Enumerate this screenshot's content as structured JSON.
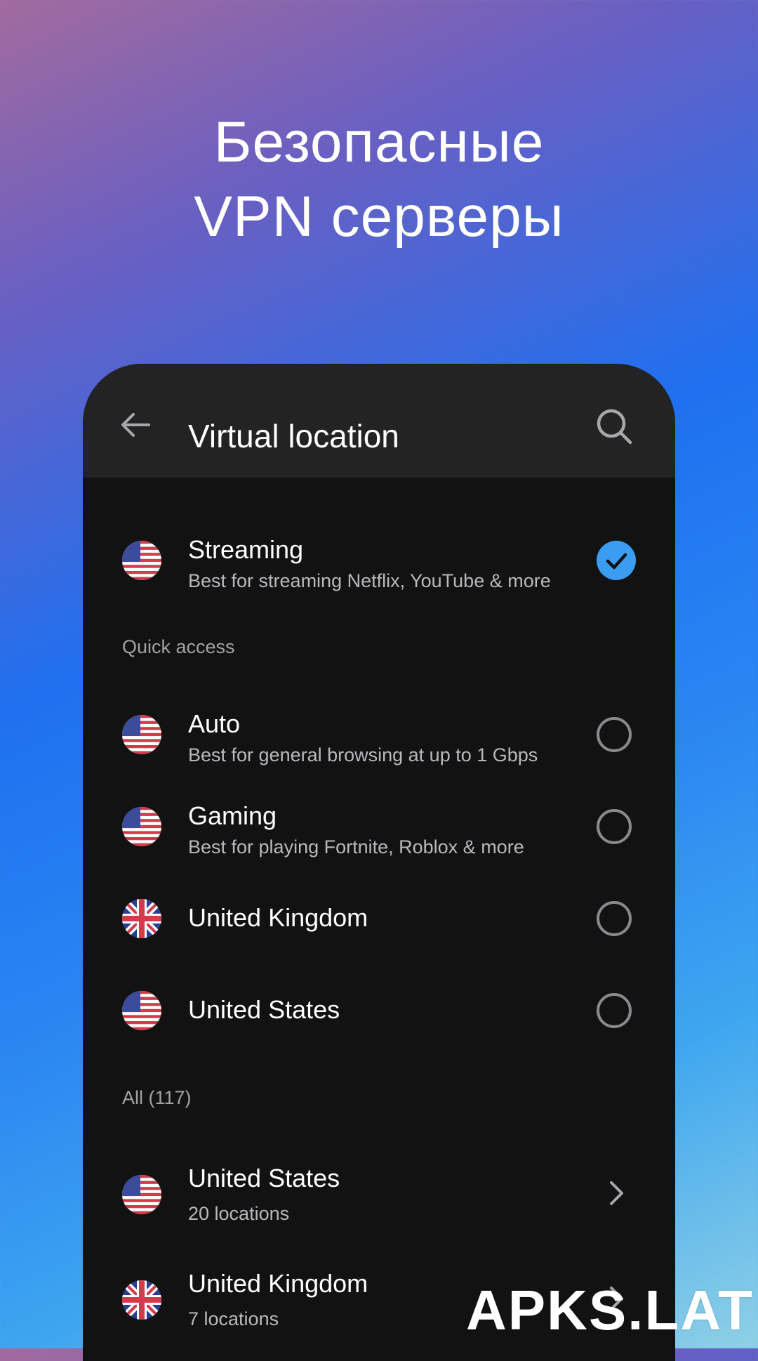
{
  "headline": {
    "line1": "Безопасные",
    "line2": "VPN серверы"
  },
  "appbar": {
    "title": "Virtual location",
    "back_icon": "arrow-left-icon",
    "search_icon": "search-icon"
  },
  "selected": {
    "title": "Streaming",
    "subtitle": "Best for streaming Netflix, YouTube & more",
    "flag": "us-flag-icon",
    "selected": true
  },
  "quick_access": {
    "label": "Quick access",
    "items": [
      {
        "title": "Auto",
        "subtitle": "Best for general browsing at up to 1 Gbps",
        "flag": "us-flag-icon",
        "selected": false
      },
      {
        "title": "Gaming",
        "subtitle": "Best for playing Fortnite, Roblox & more",
        "flag": "us-flag-icon",
        "selected": false
      },
      {
        "title": "United Kingdom",
        "subtitle": "",
        "flag": "uk-flag-icon",
        "selected": false
      },
      {
        "title": "United States",
        "subtitle": "",
        "flag": "us-flag-icon",
        "selected": false
      }
    ]
  },
  "all": {
    "label": "All (117)",
    "items": [
      {
        "title": "United States",
        "subtitle": "20 locations",
        "flag": "us-flag-icon"
      },
      {
        "title": "United Kingdom",
        "subtitle": "7 locations",
        "flag": "uk-flag-icon"
      }
    ]
  },
  "watermark": "APKS.LAT",
  "colors": {
    "accent": "#3a9df2",
    "panel": "#121213",
    "appbar": "#232324"
  }
}
